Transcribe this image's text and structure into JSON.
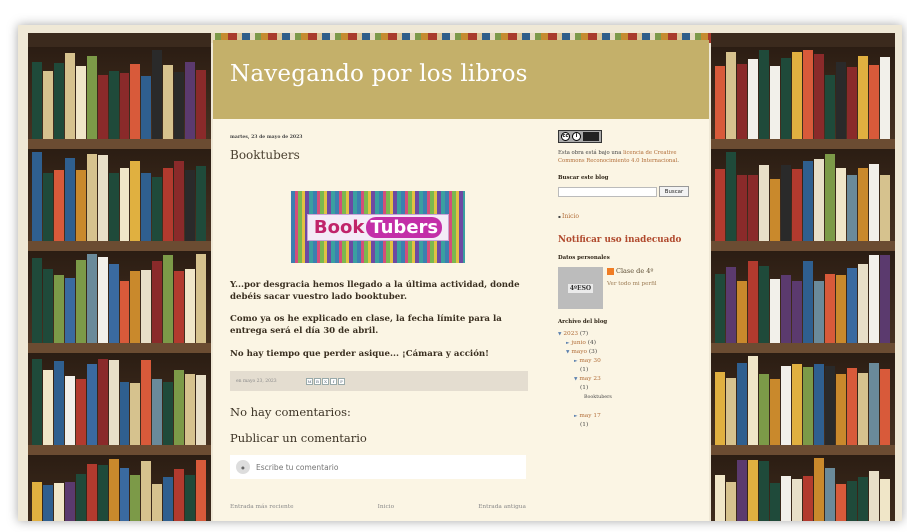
{
  "blog": {
    "title": "Navegando por los libros"
  },
  "post": {
    "date": "martes, 23 de mayo de 2023",
    "title": "Booktubers",
    "image_words": [
      "Book",
      "Tubers"
    ],
    "paragraphs": [
      "Y...por desgracia hemos llegado a la última actividad, donde debéis  sacar vuestro lado booktuber.",
      "Como ya os he explicado en clase, la fecha límite para la entrega será el día 30 de abril.",
      "No hay tiempo que perder asique... ¡Cámara y acción!"
    ],
    "byline": "en mayo 23, 2023",
    "share_icons": [
      "M",
      "B",
      "X",
      "f",
      "P"
    ]
  },
  "comments": {
    "none_label": "No hay comentarios:",
    "publish_label": "Publicar un comentario",
    "placeholder": "Escribe tu comentario"
  },
  "nav": {
    "newer": "Entrada más reciente",
    "home": "Inicio",
    "older": "Entrada antigua"
  },
  "sidebar": {
    "license_text": "Esta obra está bajo una",
    "license_link": "licencia de Creative Commons Reconocimiento 4.0 Internacional",
    "search_heading": "Buscar este blog",
    "search_button": "Buscar",
    "inicio": "Inicio",
    "report": "Notificar uso inadecuado",
    "profile_heading": "Datos personales",
    "profile_name": "Clase de 4º",
    "profile_link": "Ver todo mi perfil",
    "profile_img_text": "4ºESO",
    "archive_heading": "Archivo del blog",
    "archive": [
      {
        "label": "2023",
        "count": "(7)",
        "twisty": "▼"
      },
      {
        "label": "junio",
        "count": "(4)",
        "twisty": "►"
      },
      {
        "label": "mayo",
        "count": "(3)",
        "twisty": "▼"
      },
      {
        "label": "may 30",
        "count": "(1)",
        "twisty": "►"
      },
      {
        "label": "may 23",
        "count": "(1)",
        "twisty": "▼"
      },
      {
        "label": "Booktubers",
        "count": "",
        "twisty": ""
      },
      {
        "label": "may 17",
        "count": "(1)",
        "twisty": "►"
      }
    ]
  }
}
